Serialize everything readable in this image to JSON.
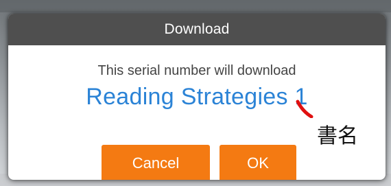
{
  "dialog": {
    "title": "Download",
    "message": "This serial number will download",
    "book_title": "Reading Strategies 1",
    "buttons": {
      "cancel_label": "Cancel",
      "ok_label": "OK"
    }
  },
  "annotation": {
    "label": "書名",
    "mark_color": "#e01010"
  },
  "colors": {
    "header_bg": "#4f4f4f",
    "title_blue": "#2b83d6",
    "button_orange": "#f47a12"
  }
}
